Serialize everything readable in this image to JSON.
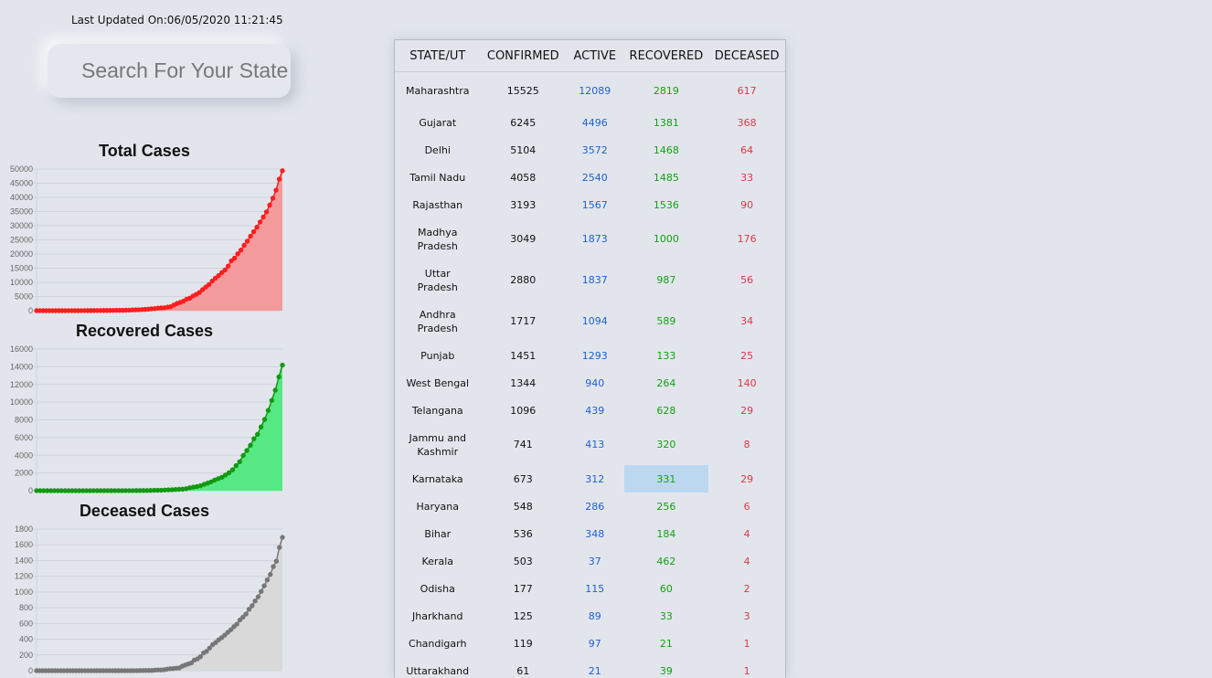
{
  "header": {
    "last_updated": "Last Updated On:06/05/2020 11:21:45"
  },
  "search": {
    "placeholder": "Search For Your State",
    "value": "",
    "icon": "magnifier-icon"
  },
  "charts": [
    {
      "title": "Total Cases"
    },
    {
      "title": "Recovered Cases"
    },
    {
      "title": "Deceased Cases"
    }
  ],
  "chart_data": [
    {
      "type": "area",
      "title": "Total Cases",
      "ylim": [
        0,
        50000
      ],
      "yticks": [
        0,
        5000,
        10000,
        15000,
        20000,
        25000,
        30000,
        35000,
        40000,
        45000,
        50000
      ],
      "color": "#ff1e1e",
      "fill": "#f29a9c",
      "grid": true,
      "values": [
        0,
        3,
        3,
        3,
        3,
        3,
        3,
        3,
        3,
        3,
        5,
        6,
        28,
        30,
        31,
        34,
        39,
        43,
        50,
        73,
        75,
        82,
        84,
        110,
        114,
        125,
        137,
        149,
        169,
        195,
        258,
        286,
        315,
        396,
        471,
        536,
        657,
        727,
        887,
        987,
        1024,
        1251,
        1397,
        1998,
        2543,
        2902,
        3374,
        4067,
        4421,
        5194,
        5734,
        6412,
        7447,
        8356,
        9205,
        10453,
        11485,
        12380,
        13430,
        14352,
        15722,
        17615,
        18539,
        20080,
        21370,
        23077,
        24530,
        26283,
        27890,
        29451,
        31324,
        33062,
        34863,
        37257,
        39699,
        42533,
        46433,
        49400
      ]
    },
    {
      "type": "area",
      "title": "Recovered Cases",
      "ylim": [
        0,
        16000
      ],
      "yticks": [
        0,
        2000,
        4000,
        6000,
        8000,
        10000,
        12000,
        14000,
        16000
      ],
      "color": "#119911",
      "fill": "#56e882",
      "grid": true,
      "values": [
        0,
        0,
        0,
        0,
        0,
        0,
        0,
        0,
        0,
        0,
        0,
        0,
        0,
        0,
        0,
        0,
        3,
        3,
        3,
        3,
        3,
        4,
        4,
        4,
        4,
        10,
        10,
        10,
        13,
        14,
        20,
        23,
        25,
        40,
        43,
        50,
        75,
        95,
        102,
        133,
        157,
        169,
        229,
        328,
        402,
        473,
        565,
        711,
        855,
        1004,
        1205,
        1366,
        1515,
        1766,
        2030,
        2361,
        2834,
        3274,
        3985,
        4539,
        5125,
        5865,
        6362,
        7202,
        8052,
        9069,
        10205,
        11349,
        12853,
        14183
      ]
    },
    {
      "type": "area",
      "title": "Deceased Cases",
      "ylim": [
        0,
        1800
      ],
      "yticks": [
        0,
        200,
        400,
        600,
        800,
        1000,
        1200,
        1400,
        1600,
        1800
      ],
      "color": "#777777",
      "fill": "#d9d9d9",
      "grid": true,
      "values": [
        0,
        0,
        0,
        0,
        0,
        0,
        0,
        0,
        0,
        0,
        0,
        0,
        0,
        0,
        0,
        0,
        0,
        0,
        0,
        0,
        0,
        0,
        0,
        0,
        0,
        0,
        0,
        0,
        0,
        0,
        0,
        0,
        1,
        1,
        2,
        2,
        3,
        3,
        4,
        7,
        10,
        10,
        12,
        20,
        25,
        27,
        32,
        35,
        58,
        72,
        86,
        99,
        136,
        150,
        178,
        226,
        246,
        288,
        331,
        358,
        393,
        420,
        452,
        488,
        521,
        559,
        592,
        645,
        681,
        721,
        780,
        825,
        886,
        939,
        1008,
        1079,
        1154,
        1223,
        1323,
        1391,
        1566,
        1694
      ]
    }
  ],
  "table": {
    "headers": [
      "STATE/UT",
      "CONFIRMED",
      "ACTIVE",
      "RECOVERED",
      "DECEASED"
    ],
    "rows": [
      {
        "state": "Maharashtra",
        "confirmed": "15525",
        "active": "12089",
        "recovered": "2819",
        "deceased": "617"
      },
      {
        "state": "Gujarat",
        "confirmed": "6245",
        "active": "4496",
        "recovered": "1381",
        "deceased": "368"
      },
      {
        "state": "Delhi",
        "confirmed": "5104",
        "active": "3572",
        "recovered": "1468",
        "deceased": "64"
      },
      {
        "state": "Tamil Nadu",
        "confirmed": "4058",
        "active": "2540",
        "recovered": "1485",
        "deceased": "33"
      },
      {
        "state": "Rajasthan",
        "confirmed": "3193",
        "active": "1567",
        "recovered": "1536",
        "deceased": "90"
      },
      {
        "state": "Madhya Pradesh",
        "confirmed": "3049",
        "active": "1873",
        "recovered": "1000",
        "deceased": "176"
      },
      {
        "state": "Uttar Pradesh",
        "confirmed": "2880",
        "active": "1837",
        "recovered": "987",
        "deceased": "56"
      },
      {
        "state": "Andhra Pradesh",
        "confirmed": "1717",
        "active": "1094",
        "recovered": "589",
        "deceased": "34"
      },
      {
        "state": "Punjab",
        "confirmed": "1451",
        "active": "1293",
        "recovered": "133",
        "deceased": "25"
      },
      {
        "state": "West Bengal",
        "confirmed": "1344",
        "active": "940",
        "recovered": "264",
        "deceased": "140"
      },
      {
        "state": "Telangana",
        "confirmed": "1096",
        "active": "439",
        "recovered": "628",
        "deceased": "29"
      },
      {
        "state": "Jammu and Kashmir",
        "confirmed": "741",
        "active": "413",
        "recovered": "320",
        "deceased": "8"
      },
      {
        "state": "Karnataka",
        "confirmed": "673",
        "active": "312",
        "recovered": "331",
        "deceased": "29",
        "selected": true
      },
      {
        "state": "Haryana",
        "confirmed": "548",
        "active": "286",
        "recovered": "256",
        "deceased": "6"
      },
      {
        "state": "Bihar",
        "confirmed": "536",
        "active": "348",
        "recovered": "184",
        "deceased": "4"
      },
      {
        "state": "Kerala",
        "confirmed": "503",
        "active": "37",
        "recovered": "462",
        "deceased": "4"
      },
      {
        "state": "Odisha",
        "confirmed": "177",
        "active": "115",
        "recovered": "60",
        "deceased": "2"
      },
      {
        "state": "Jharkhand",
        "confirmed": "125",
        "active": "89",
        "recovered": "33",
        "deceased": "3"
      },
      {
        "state": "Chandigarh",
        "confirmed": "119",
        "active": "97",
        "recovered": "21",
        "deceased": "1"
      },
      {
        "state": "Uttarakhand",
        "confirmed": "61",
        "active": "21",
        "recovered": "39",
        "deceased": "1"
      }
    ]
  }
}
